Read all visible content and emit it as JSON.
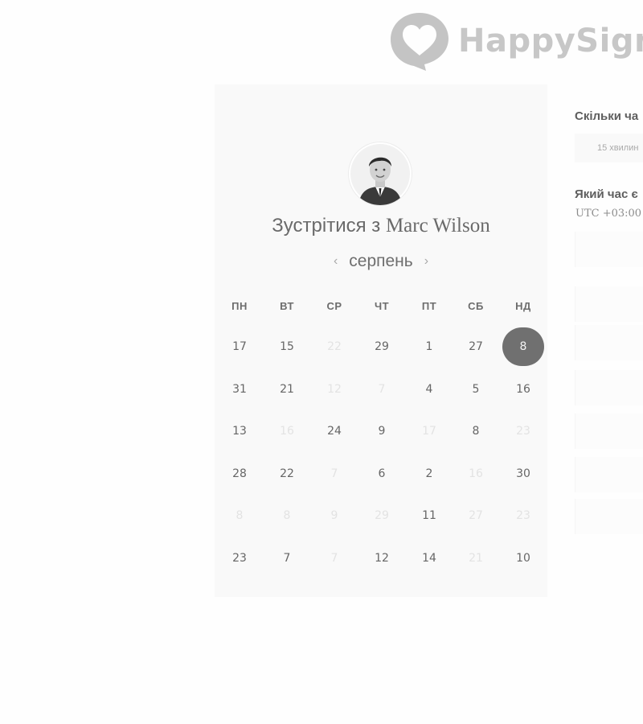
{
  "header": {
    "brand_text": "HappySign"
  },
  "profile": {
    "title_prefix": "Зустрітися з ",
    "name": "Marc Wilson",
    "avatar_alt": "Marc Wilson"
  },
  "calendar": {
    "month": "серпень",
    "prev_icon": "chevron-left-icon",
    "next_icon": "chevron-right-icon",
    "weekdays": [
      "ПН",
      "ВТ",
      "СР",
      "ЧТ",
      "ПТ",
      "СБ",
      "НД"
    ],
    "weeks": [
      [
        {
          "n": "17",
          "active": true
        },
        {
          "n": "15",
          "active": true
        },
        {
          "n": "22",
          "active": false
        },
        {
          "n": "29",
          "active": true
        },
        {
          "n": "1",
          "active": true
        },
        {
          "n": "27",
          "active": true
        },
        {
          "n": "8",
          "active": true,
          "selected": true
        }
      ],
      [
        {
          "n": "31",
          "active": true
        },
        {
          "n": "21",
          "active": true
        },
        {
          "n": "12",
          "active": false
        },
        {
          "n": "7",
          "active": false
        },
        {
          "n": "4",
          "active": true
        },
        {
          "n": "5",
          "active": true
        },
        {
          "n": "16",
          "active": true
        }
      ],
      [
        {
          "n": "13",
          "active": true
        },
        {
          "n": "16",
          "active": false
        },
        {
          "n": "24",
          "active": true
        },
        {
          "n": "9",
          "active": true
        },
        {
          "n": "17",
          "active": false
        },
        {
          "n": "8",
          "active": true
        },
        {
          "n": "23",
          "active": false
        }
      ],
      [
        {
          "n": "28",
          "active": true
        },
        {
          "n": "22",
          "active": true
        },
        {
          "n": "7",
          "active": false
        },
        {
          "n": "6",
          "active": true
        },
        {
          "n": "2",
          "active": true
        },
        {
          "n": "16",
          "active": false
        },
        {
          "n": "30",
          "active": true
        }
      ],
      [
        {
          "n": "8",
          "active": false
        },
        {
          "n": "8",
          "active": false
        },
        {
          "n": "9",
          "active": false
        },
        {
          "n": "29",
          "active": false
        },
        {
          "n": "11",
          "active": true
        },
        {
          "n": "27",
          "active": false
        },
        {
          "n": "23",
          "active": false
        }
      ],
      [
        {
          "n": "23",
          "active": true
        },
        {
          "n": "7",
          "active": true
        },
        {
          "n": "7",
          "active": false
        },
        {
          "n": "12",
          "active": true
        },
        {
          "n": "14",
          "active": true
        },
        {
          "n": "21",
          "active": false
        },
        {
          "n": "10",
          "active": true
        }
      ]
    ]
  },
  "sidebar": {
    "duration_heading": "Скільки ча",
    "duration_value": "15 хвилин",
    "time_heading": "Який час є",
    "timezone": "UTC +03:00"
  },
  "colors": {
    "selected_day": "#707070",
    "card_bg": "#f9f9f9",
    "logo": "#c7c7c7"
  }
}
